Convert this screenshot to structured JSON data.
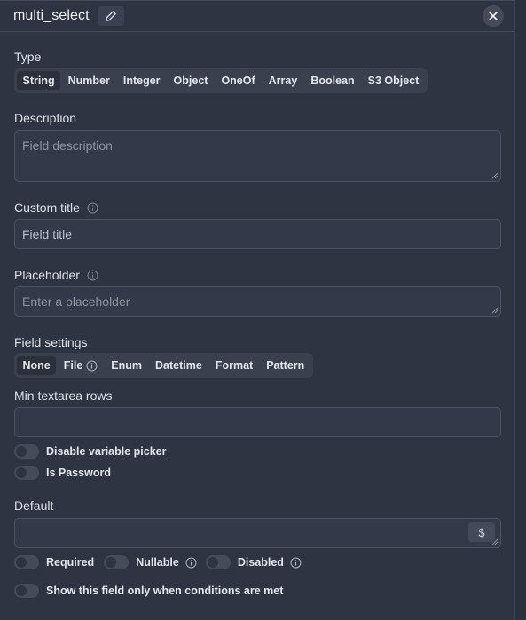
{
  "header": {
    "field_name": "multi_select",
    "edit_icon": "pencil-icon",
    "close_icon": "close-icon"
  },
  "type": {
    "label": "Type",
    "options": [
      "String",
      "Number",
      "Integer",
      "Object",
      "OneOf",
      "Array",
      "Boolean",
      "S3 Object"
    ],
    "selected": "String"
  },
  "description": {
    "label": "Description",
    "placeholder": "Field description"
  },
  "custom_title": {
    "label": "Custom title",
    "value": "Field title"
  },
  "placeholder_field": {
    "label": "Placeholder",
    "placeholder": "Enter a placeholder"
  },
  "field_settings": {
    "label": "Field settings",
    "options": [
      "None",
      "File",
      "Enum",
      "Datetime",
      "Format",
      "Pattern"
    ],
    "selected": "None"
  },
  "min_rows": {
    "label": "Min textarea rows",
    "value": ""
  },
  "toggles": {
    "disable_variable_picker": "Disable variable picker",
    "is_password": "Is Password"
  },
  "default": {
    "label": "Default",
    "value": "",
    "dollar_label": "$"
  },
  "flags": {
    "required": "Required",
    "nullable": "Nullable",
    "disabled": "Disabled",
    "conditional": "Show this field only when conditions are met"
  },
  "colors": {
    "background": "#2e3442",
    "segment_bg": "#3a404e",
    "segment_active": "#2b303b",
    "input_border": "#4b5262"
  }
}
